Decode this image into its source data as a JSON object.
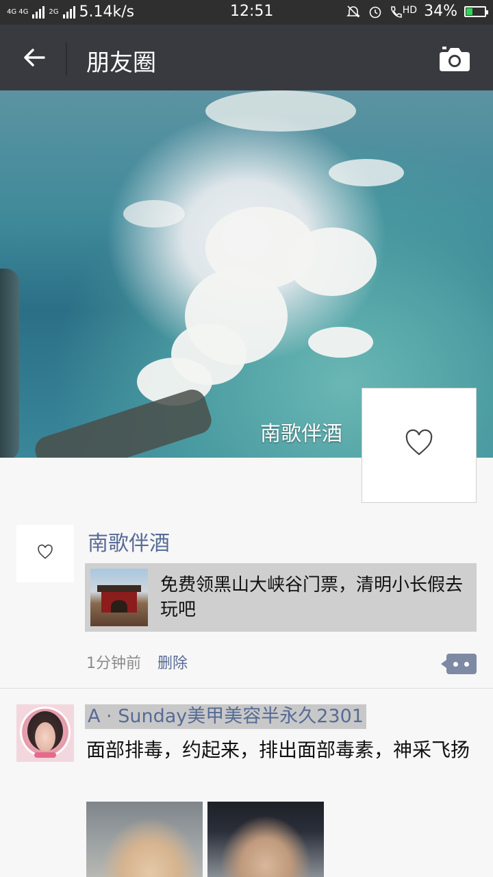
{
  "status_bar": {
    "network": "4G 4G",
    "network2": "2G",
    "speed": "5.14k/s",
    "time": "12:51",
    "battery_percent": "34%",
    "battery_level": 0.34,
    "hd_label": "HD",
    "icons": [
      "mute-bell-icon",
      "alarm-icon",
      "hd-call-icon",
      "battery-icon"
    ]
  },
  "header": {
    "title": "朋友圈",
    "back_icon": "arrow-left-icon",
    "camera_icon": "camera-icon"
  },
  "cover": {
    "name": "南歌伴酒",
    "avatar_icon": "heart-outline-icon"
  },
  "posts": [
    {
      "nickname": "南歌伴酒",
      "avatar_icon": "heart-outline-icon",
      "share_text": "免费领黑山大峡谷门票，清明小长假去玩吧",
      "time_ago": "1分钟前",
      "delete_label": "删除",
      "more_icon": "comment-more-icon"
    },
    {
      "nickname": "A · Sunday美甲美容半永久2301",
      "text": "面部排毒，约起来，排出面部毒素，神采飞扬"
    }
  ],
  "colors": {
    "header_bg": "#393a3f",
    "status_bg": "#2f2f2f",
    "nickname": "#576b95",
    "page_bg": "#f7f7f7"
  }
}
